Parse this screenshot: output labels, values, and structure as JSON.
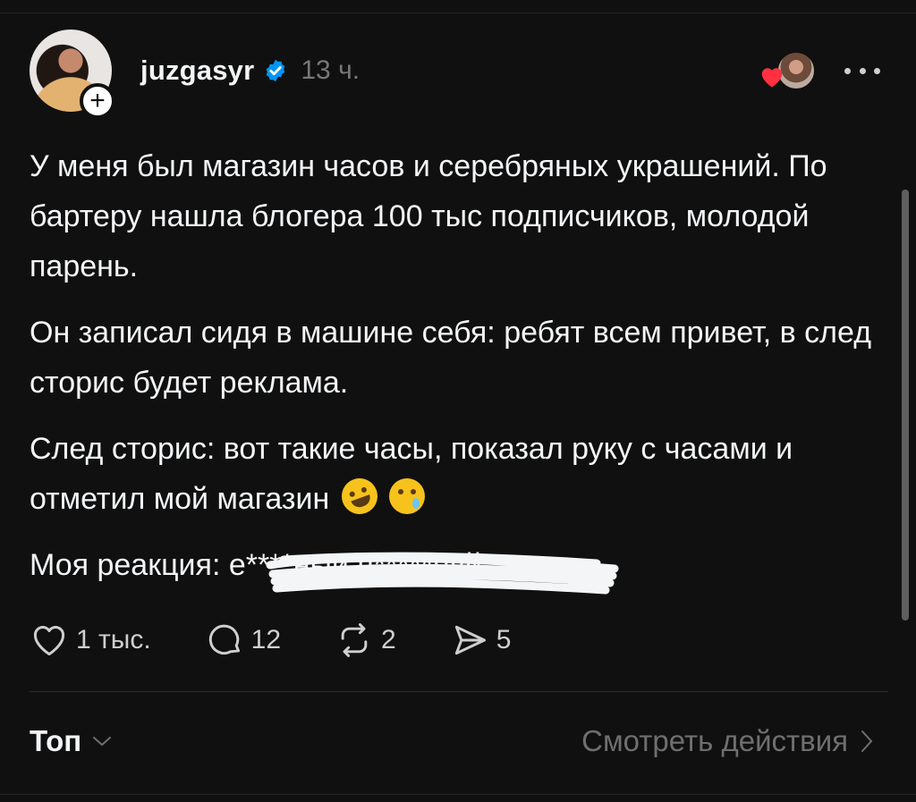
{
  "post": {
    "username": "juzgasyr",
    "time": "13 ч.",
    "paragraphs": [
      "У меня был магазин часов и серебряных украшений. По бартеру нашла блогера 100 тыс подписчиков, молодой парень.",
      "Он записал сидя в машине себя: ребят всем привет, в след сторис будет реклама.",
      "След сторис: вот такие часы, показал руку с часами и отметил мой магазин"
    ],
    "reaction_label": "Моя реакция:",
    "reaction_hidden": "е****ныи п*****нуй"
  },
  "actions": {
    "likes": "1 тыс.",
    "replies": "12",
    "reposts": "2",
    "shares": "5"
  },
  "footer": {
    "sort_label": "Топ",
    "view_activity": "Смотреть действия"
  },
  "icons": {
    "avatar": "avatar-photo",
    "follow": "plus-icon",
    "verified": "verified-badge-icon",
    "liked_by": "heart-icon",
    "more": "more-icon",
    "like": "heart-outline-icon",
    "reply": "comment-icon",
    "repost": "repost-icon",
    "share": "send-icon",
    "sort": "chevron-down-icon",
    "activity": "chevron-right-icon"
  },
  "colors": {
    "background": "#101010",
    "verified": "#0095f6",
    "heart": "#ff3040"
  }
}
